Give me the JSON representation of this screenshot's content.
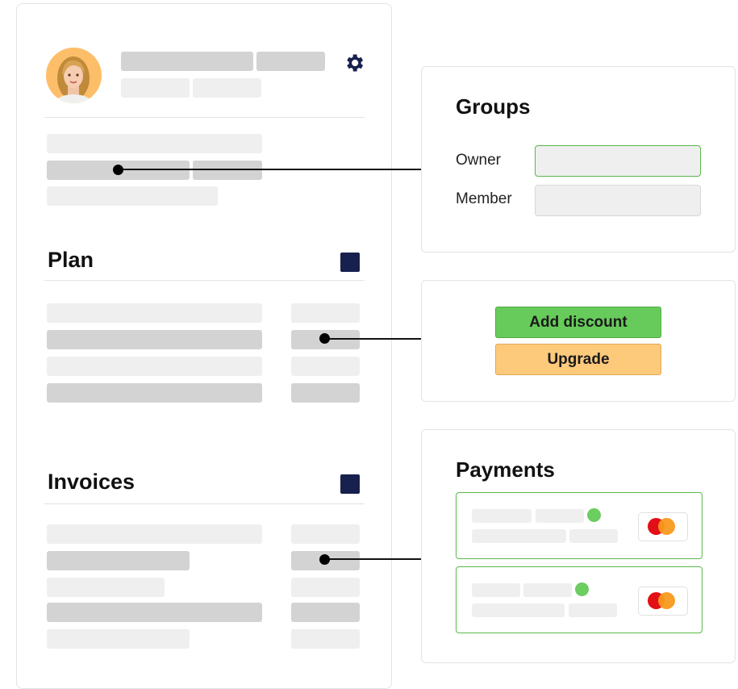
{
  "profile": {
    "avatar_icon": "user-avatar",
    "settings_icon": "gear-icon"
  },
  "plan": {
    "title": "Plan"
  },
  "invoices": {
    "title": "Invoices"
  },
  "groups": {
    "title": "Groups",
    "owner_label": "Owner",
    "member_label": "Member"
  },
  "actions": {
    "add_discount_label": "Add discount",
    "upgrade_label": "Upgrade"
  },
  "payments": {
    "title": "Payments",
    "card_brand_icon": "mastercard-icon"
  },
  "colors": {
    "accent_green": "#67cb5b",
    "accent_orange": "#fdc97b",
    "navy": "#18204d",
    "status_green": "#6ccd61"
  }
}
